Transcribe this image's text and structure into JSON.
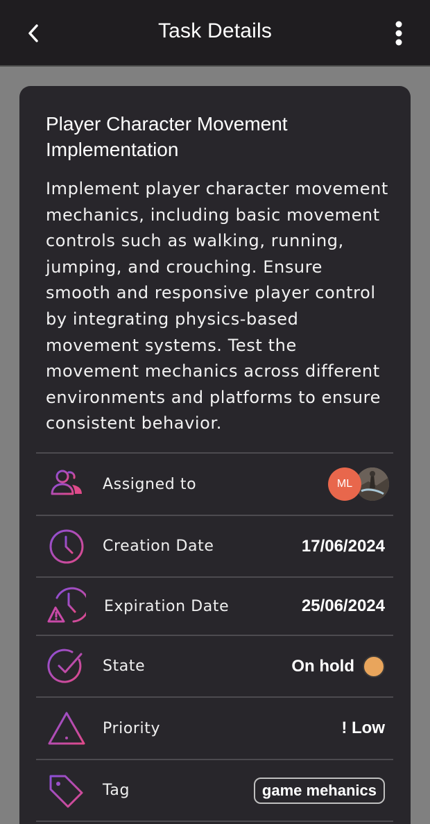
{
  "header": {
    "title": "Task Details"
  },
  "task": {
    "title": "Player Character Movement Implementation",
    "description": "Implement player character movement mechanics, including basic movement controls such as walking, running, jumping, and crouching. Ensure smooth and responsive player control by integrating physics-based movement systems. Test the movement mechanics across different environments and platforms to ensure consistent behavior."
  },
  "details": {
    "assigned": {
      "label": "Assigned to",
      "avatar_initials": "ML"
    },
    "creation": {
      "label": "Creation Date",
      "value": "17/06/2024"
    },
    "expiration": {
      "label": "Expiration Date",
      "value": "25/06/2024"
    },
    "state": {
      "label": "State",
      "value": "On hold",
      "color": "#e9a55c"
    },
    "priority": {
      "label": "Priority",
      "value": "! Low"
    },
    "tag": {
      "label": "Tag",
      "value": "game mehanics"
    }
  },
  "icons": {
    "back": "chevron-left-icon",
    "more": "more-vertical-icon",
    "assigned": "users-icon",
    "creation": "clock-icon",
    "expiration": "clock-alert-icon",
    "state": "check-circle-icon",
    "priority": "warning-triangle-icon",
    "tag": "tag-icon"
  },
  "colors": {
    "gradient_start": "#8b4fd6",
    "gradient_end": "#e04a8a",
    "avatar_ml": "#e8674c"
  }
}
